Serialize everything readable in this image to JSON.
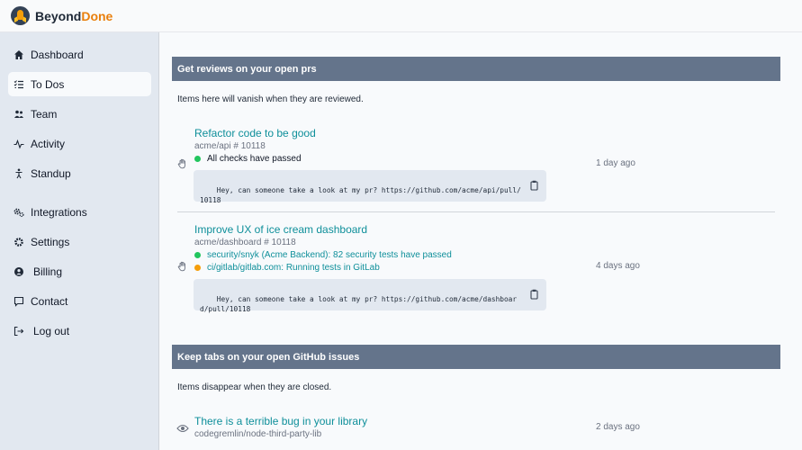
{
  "brand": {
    "name_part1": "Beyond",
    "name_part2": "Done",
    "accent_color": "#e97f0c"
  },
  "sidebar": {
    "items": [
      {
        "label": "Dashboard",
        "icon": "home-icon"
      },
      {
        "label": "To Dos",
        "icon": "checklist-icon",
        "active": true
      },
      {
        "label": "Team",
        "icon": "team-icon"
      },
      {
        "label": "Activity",
        "icon": "activity-icon"
      },
      {
        "label": "Standup",
        "icon": "standup-icon"
      },
      {
        "label": "Integrations",
        "icon": "integrations-icon"
      },
      {
        "label": "Settings",
        "icon": "gear-icon"
      },
      {
        "label": "Billing",
        "icon": "user-circle-icon"
      },
      {
        "label": "Contact",
        "icon": "chat-icon"
      },
      {
        "label": "Log out",
        "icon": "logout-icon"
      }
    ]
  },
  "reviews": {
    "title": "Get reviews on your open prs",
    "description": "Items here will vanish when they are reviewed.",
    "prs": [
      {
        "title": "Refactor code to be good",
        "repo": "acme/api # 10118",
        "checks": [
          {
            "status": "success",
            "text": "All checks have passed"
          }
        ],
        "message": "Hey, can someone take a look at my pr? https://github.com/acme/api/pull/10118",
        "time": "1 day ago"
      },
      {
        "title": "Improve UX of ice cream dashboard",
        "repo": "acme/dashboard # 10118",
        "checks": [
          {
            "status": "success",
            "text": "security/snyk (Acme Backend): 82 security tests have passed"
          },
          {
            "status": "pending",
            "text": "ci/gitlab/gitlab.com: Running tests in GitLab"
          }
        ],
        "message": "Hey, can someone take a look at my pr? https://github.com/acme/dashboard/pull/10118",
        "time": "4 days ago"
      }
    ]
  },
  "issues": {
    "title": "Keep tabs on your open GitHub issues",
    "description": "Items disappear when they are closed.",
    "items": [
      {
        "title": "There is a terrible bug in your library",
        "repo": "codegremlin/node-third-party-lib",
        "time": "2 days ago"
      }
    ]
  },
  "colors": {
    "section_header": "#64748b",
    "link": "#0e8f9a",
    "success": "#22c55e",
    "pending": "#f59e0b",
    "sidebar_bg": "#e2e8f0"
  }
}
